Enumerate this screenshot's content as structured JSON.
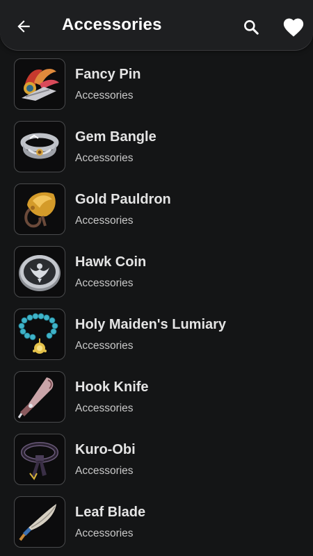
{
  "appbar": {
    "title": "Accessories",
    "icons": {
      "back": "arrow-left-icon",
      "search": "search-icon",
      "favorite": "heart-icon"
    }
  },
  "items": [
    {
      "name": "Fancy Pin",
      "category": "Accessories",
      "icon": "fancy-pin-image"
    },
    {
      "name": "Gem Bangle",
      "category": "Accessories",
      "icon": "gem-bangle-image"
    },
    {
      "name": "Gold Pauldron",
      "category": "Accessories",
      "icon": "gold-pauldron-image"
    },
    {
      "name": "Hawk Coin",
      "category": "Accessories",
      "icon": "hawk-coin-image"
    },
    {
      "name": "Holy Maiden's Lumiary",
      "category": "Accessories",
      "icon": "holy-maidens-lumiary-image"
    },
    {
      "name": "Hook Knife",
      "category": "Accessories",
      "icon": "hook-knife-image"
    },
    {
      "name": "Kuro-Obi",
      "category": "Accessories",
      "icon": "kuro-obi-image"
    },
    {
      "name": "Leaf Blade",
      "category": "Accessories",
      "icon": "leaf-blade-image"
    }
  ]
}
